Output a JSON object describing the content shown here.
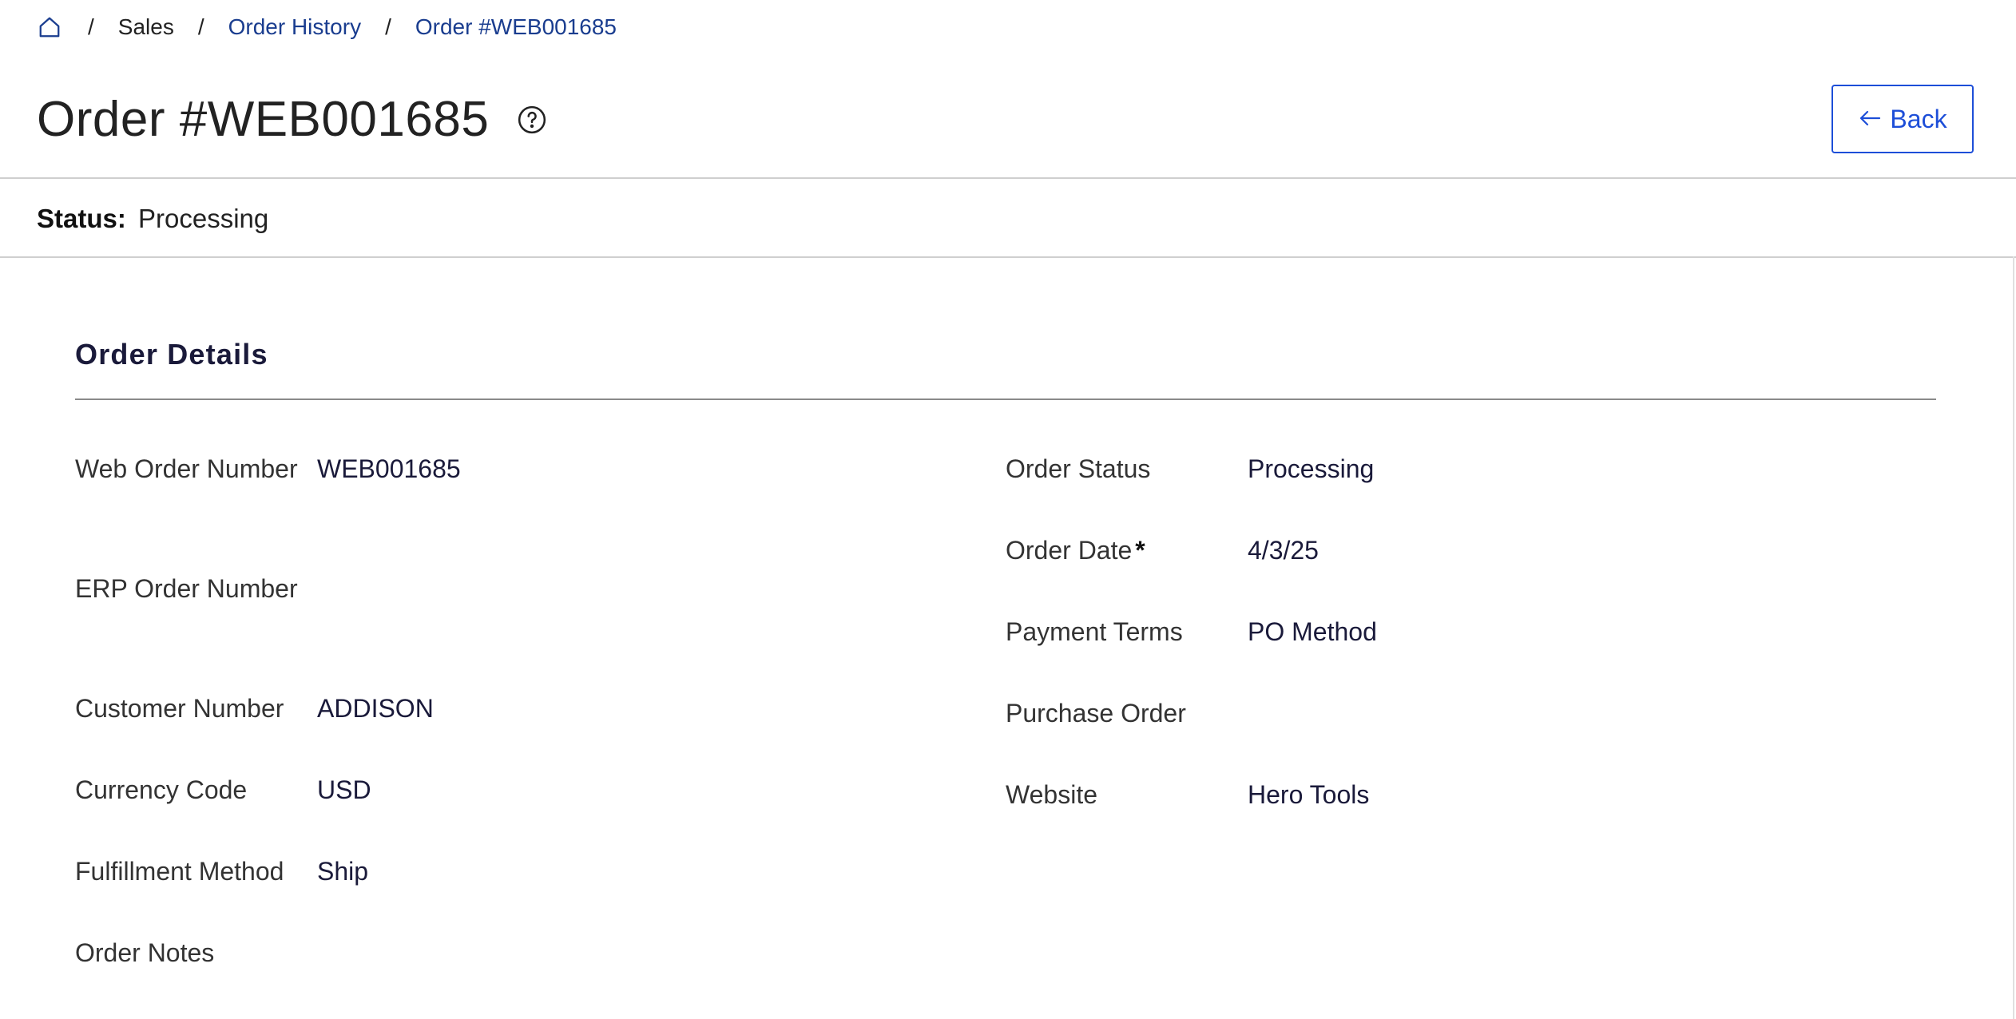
{
  "breadcrumb": {
    "home_icon": "home-icon",
    "items": [
      "Sales",
      "Order History",
      "Order #WEB001685"
    ]
  },
  "header": {
    "title": "Order #WEB001685",
    "help_icon": "help-circle-icon",
    "back_label": "Back",
    "back_icon": "arrow-left-icon"
  },
  "status": {
    "label": "Status:",
    "value": "Processing"
  },
  "order_details": {
    "heading": "Order Details",
    "left": [
      {
        "label": "Web Order Number",
        "value": "WEB001685"
      },
      {
        "label": "ERP Order Number",
        "value": ""
      },
      {
        "label": "Customer Number",
        "value": "ADDISON"
      },
      {
        "label": "Currency Code",
        "value": "USD"
      },
      {
        "label": "Fulfillment Method",
        "value": "Ship"
      },
      {
        "label": "Order Notes",
        "value": ""
      }
    ],
    "right": [
      {
        "label": "Order Status",
        "value": "Processing"
      },
      {
        "label": "Order Date",
        "value": "4/3/25",
        "required_mark": "*"
      },
      {
        "label": "Payment Terms",
        "value": "PO Method"
      },
      {
        "label": "Purchase Order",
        "value": ""
      },
      {
        "label": "Website",
        "value": "Hero Tools"
      }
    ]
  },
  "colors": {
    "link": "#1a3d8f",
    "button_accent": "#1d4ed8",
    "heading": "#1a1a3a"
  }
}
